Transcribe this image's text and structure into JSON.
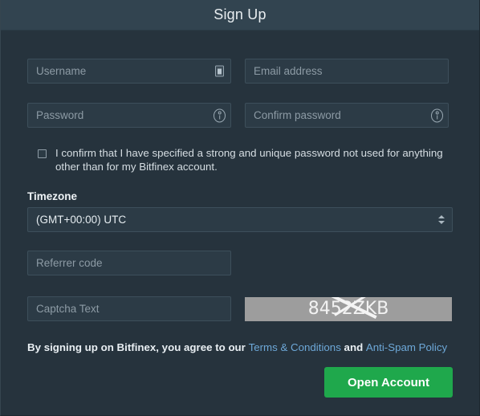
{
  "modal": {
    "title": "Sign Up"
  },
  "form": {
    "username": {
      "placeholder": "Username",
      "value": "",
      "icon": "id-card-icon"
    },
    "email": {
      "placeholder": "Email address",
      "value": ""
    },
    "password": {
      "placeholder": "Password",
      "value": "",
      "icon": "key-icon"
    },
    "confirm_password": {
      "placeholder": "Confirm password",
      "value": "",
      "icon": "key-icon"
    },
    "confirm_checkbox": {
      "checked": false,
      "label": "I confirm that I have specified a strong and unique password not used for anything other than for my Bitfinex account."
    },
    "timezone": {
      "label": "Timezone",
      "selected": "(GMT+00:00) UTC",
      "options": [
        "(GMT+00:00) UTC"
      ],
      "icon": "updown-arrows-icon"
    },
    "referrer": {
      "placeholder": "Referrer code",
      "value": ""
    },
    "captcha": {
      "placeholder": "Captcha Text",
      "value": "",
      "image_text": "8452ZKB"
    }
  },
  "footer": {
    "terms_prefix": "By signing up on Bitfinex, you agree to our ",
    "terms_link": "Terms & Conditions",
    "terms_middle": " and ",
    "antispam_link": "Anti-Spam Policy",
    "submit_label": "Open Account"
  },
  "colors": {
    "background": "#26333d",
    "header": "#324450",
    "input_background": "#2c3b46",
    "input_border": "#3d4f5b",
    "accent_green": "#1fa84c",
    "link_blue": "#6da8d8",
    "captcha_background": "#9d9d9d"
  }
}
